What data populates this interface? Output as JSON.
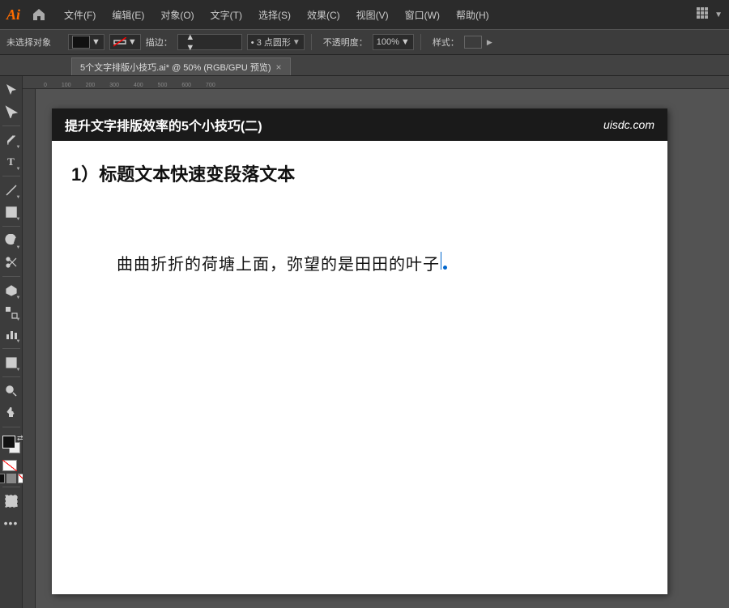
{
  "app": {
    "logo": "Ai",
    "title": "Adobe Illustrator"
  },
  "menu": {
    "items": [
      {
        "label": "文件(F)"
      },
      {
        "label": "编辑(E)"
      },
      {
        "label": "对象(O)"
      },
      {
        "label": "文字(T)"
      },
      {
        "label": "选择(S)"
      },
      {
        "label": "效果(C)"
      },
      {
        "label": "视图(V)"
      },
      {
        "label": "窗口(W)"
      },
      {
        "label": "帮助(H)"
      }
    ]
  },
  "options_bar": {
    "no_selection": "未选择对象",
    "stroke_label": "描边：",
    "bullet_label": "• 3 点圆形",
    "opacity_label": "不透明度：",
    "opacity_value": "100%",
    "style_label": "样式："
  },
  "tab": {
    "label": "5个文字排版小技巧.ai* @ 50% (RGB/GPU 预览)",
    "close": "×"
  },
  "document": {
    "header_title": "提升文字排版效率的5个小技巧(二)",
    "header_brand": "uisdc.com",
    "section_title": "1）标题文本快速变段落文本",
    "text_line": "曲曲折折的荷塘上面，弥望的是田田的叶子"
  },
  "toolbar": {
    "tools": [
      {
        "name": "selection",
        "icon": "▶",
        "label": "选择工具"
      },
      {
        "name": "direct-selection",
        "icon": "↖",
        "label": "直接选择工具"
      },
      {
        "name": "pen",
        "icon": "✒",
        "label": "钢笔工具"
      },
      {
        "name": "type",
        "icon": "T",
        "label": "文字工具"
      },
      {
        "name": "line",
        "icon": "/",
        "label": "直线工具"
      },
      {
        "name": "shape",
        "icon": "□",
        "label": "矩形工具"
      },
      {
        "name": "transform",
        "icon": "◈",
        "label": "变换工具"
      },
      {
        "name": "scissors",
        "icon": "✂",
        "label": "剪刀工具"
      },
      {
        "name": "recolor",
        "icon": "⬡",
        "label": "重新着色工具"
      },
      {
        "name": "blend",
        "icon": "⊞",
        "label": "混合工具"
      },
      {
        "name": "chart",
        "icon": "▣",
        "label": "图表工具"
      },
      {
        "name": "gradient",
        "icon": "◫",
        "label": "渐变工具"
      },
      {
        "name": "zoom",
        "icon": "🔍",
        "label": "缩放工具"
      },
      {
        "name": "hand",
        "icon": "✋",
        "label": "抓手工具"
      }
    ]
  },
  "colors": {
    "accent": "#0066cc",
    "toolbar_bg": "#3c3c3c",
    "menu_bg": "#2b2b2b",
    "canvas_bg": "#535353",
    "doc_bg": "#ffffff"
  }
}
